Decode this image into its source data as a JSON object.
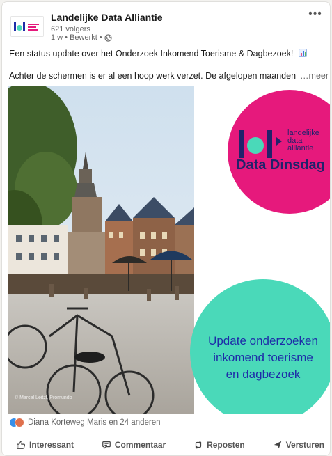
{
  "post": {
    "author": {
      "name": "Landelijke Data Alliantie",
      "followers": "621 volgers",
      "meta": "1 w • Bewerkt •",
      "logo_icon": "lda-logo-icon"
    },
    "more_icon": "more-options-icon",
    "text_line1": "Een status update over het Onderzoek Inkomend Toerisme & Dagbezoek!",
    "text_line2": "Achter de schermen is er al een hoop werk verzet. De afgelopen maanden",
    "see_more": "…meer",
    "image": {
      "photo_credit": "© Marcel Leitzl, Promundo",
      "badge_lines": [
        "landelijke",
        "data",
        "alliantie"
      ],
      "badge_title": "Data Dinsdag",
      "teal_lines": [
        "Update onderzoeken",
        "inkomend toerisme",
        "en dagbezoek"
      ],
      "colors": {
        "pink": "#e6197c",
        "teal": "#4ad9b9",
        "navy": "#21226b",
        "blue_text": "#1e2da8"
      }
    },
    "social_counts": "Diana Korteweg Maris en 24 anderen",
    "actions": [
      {
        "label": "Interessant",
        "icon": "thumbs-up-icon"
      },
      {
        "label": "Commentaar",
        "icon": "comment-icon"
      },
      {
        "label": "Reposten",
        "icon": "repost-icon"
      },
      {
        "label": "Versturen",
        "icon": "send-icon"
      }
    ]
  }
}
